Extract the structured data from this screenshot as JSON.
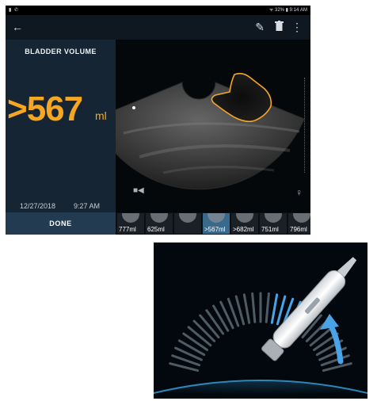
{
  "statusbar": {
    "left": "▮ ✆",
    "right": "ᯤ 32% ▮ 9:14 AM"
  },
  "toolbar": {
    "back_icon": "←",
    "edit_icon": "✎",
    "trash_icon": "🗑",
    "more_icon": "⋮"
  },
  "result": {
    "title": "BLADDER VOLUME",
    "value": ">567",
    "unit": "ml",
    "date": "12/27/2018",
    "time": "9:27 AM"
  },
  "done_label": "DONE",
  "icons": {
    "camera": "■◀",
    "body": "♀"
  },
  "thumbnails": [
    {
      "label": "777ml"
    },
    {
      "label": "625ml"
    },
    {
      "label": ""
    },
    {
      "label": ">567ml",
      "selected": true
    },
    {
      "label": ">682ml"
    },
    {
      "label": "751ml"
    },
    {
      "label": "796ml"
    }
  ],
  "colors": {
    "accent": "#f5a623",
    "left_panel": "#152533",
    "done": "#233b51",
    "highlight": "#4aa3e6"
  }
}
